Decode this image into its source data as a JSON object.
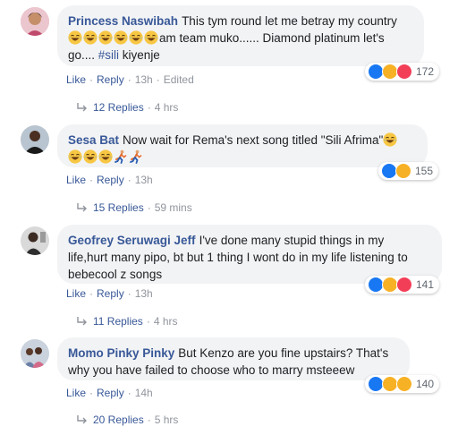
{
  "comments": [
    {
      "author": "Princess Naswibah",
      "text_line1": "This tym round let me betray my country",
      "text_line2_after_emojis": "am team muko...... Diamond platinum let's",
      "text_line3": "go.... ",
      "hashtag": "#sili",
      "text_line3_after": " kiyenje",
      "emoji_count": 6,
      "reactions": [
        "like-icon",
        "haha-icon",
        "love-icon"
      ],
      "reaction_count": "172",
      "like_label": "Like",
      "reply_label": "Reply",
      "time": "13h",
      "edited": "Edited",
      "replies_label": "12 Replies",
      "replies_time": "4 hrs"
    },
    {
      "author": "Sesa Bat",
      "text_line1": "Now wait for Rema's next song titled \"Sili Afrima\"",
      "reactions": [
        "like-icon",
        "haha-icon"
      ],
      "reaction_count": "155",
      "like_label": "Like",
      "reply_label": "Reply",
      "time": "13h",
      "replies_label": "15 Replies",
      "replies_time": "59 mins"
    },
    {
      "author": "Geofrey Seruwagi Jeff",
      "text_line1": "I've done many stupid things in my",
      "text_line2": "life,hurt many pipo, bt but 1 thing I wont do in my life listening to",
      "text_line3": "bebecool z songs",
      "reactions": [
        "like-icon",
        "haha-icon",
        "love-icon"
      ],
      "reaction_count": "141",
      "like_label": "Like",
      "reply_label": "Reply",
      "time": "13h",
      "replies_label": "11 Replies",
      "replies_time": "4 hrs"
    },
    {
      "author": "Momo Pinky Pinky",
      "text_line1": "But Kenzo are you fine upstairs? That's",
      "text_line2": "why you have failed to choose who to marry msteeew",
      "reactions": [
        "like-icon",
        "haha-icon",
        "wow-icon"
      ],
      "reaction_count": "140",
      "like_label": "Like",
      "reply_label": "Reply",
      "time": "14h",
      "replies_label": "20 Replies",
      "replies_time": "5 hrs"
    }
  ],
  "colors": {
    "link": "#385898",
    "bubble": "#f2f3f5",
    "meta": "#90949c",
    "like": "#1877f2",
    "love": "#f33e58",
    "haha": "#f7b125"
  }
}
